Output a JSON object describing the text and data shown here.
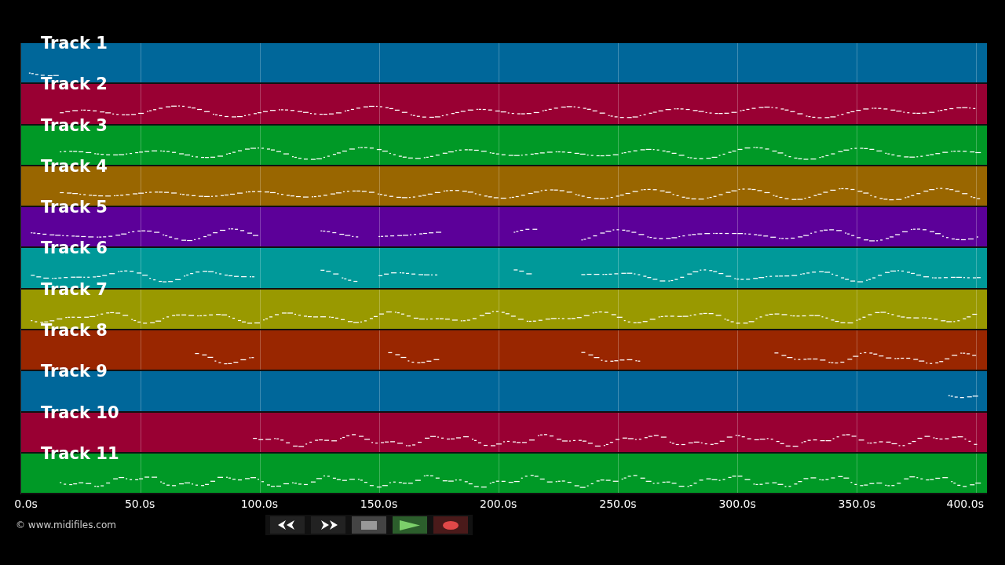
{
  "tracks": [
    {
      "name": "Track 1",
      "color": "#00679a"
    },
    {
      "name": "Track 2",
      "color": "#990033"
    },
    {
      "name": "Track 3",
      "color": "#009926"
    },
    {
      "name": "Track 4",
      "color": "#996600"
    },
    {
      "name": "Track 5",
      "color": "#5c0099"
    },
    {
      "name": "Track 6",
      "color": "#009999"
    },
    {
      "name": "Track 7",
      "color": "#999900"
    },
    {
      "name": "Track 8",
      "color": "#992600"
    },
    {
      "name": "Track 9",
      "color": "#00679a"
    },
    {
      "name": "Track 10",
      "color": "#990033"
    },
    {
      "name": "Track 11",
      "color": "#009926"
    }
  ],
  "time_axis": {
    "ticks": [
      "0.0s",
      "50.0s",
      "100.0s",
      "150.0s",
      "200.0s",
      "250.0s",
      "300.0s",
      "350.0s",
      "400.0s"
    ]
  },
  "credit": "© www.midifiles.com",
  "transport": [
    {
      "kind": "rewind"
    },
    {
      "kind": "forward"
    },
    {
      "kind": "stop"
    },
    {
      "kind": "play"
    },
    {
      "kind": "record"
    }
  ]
}
